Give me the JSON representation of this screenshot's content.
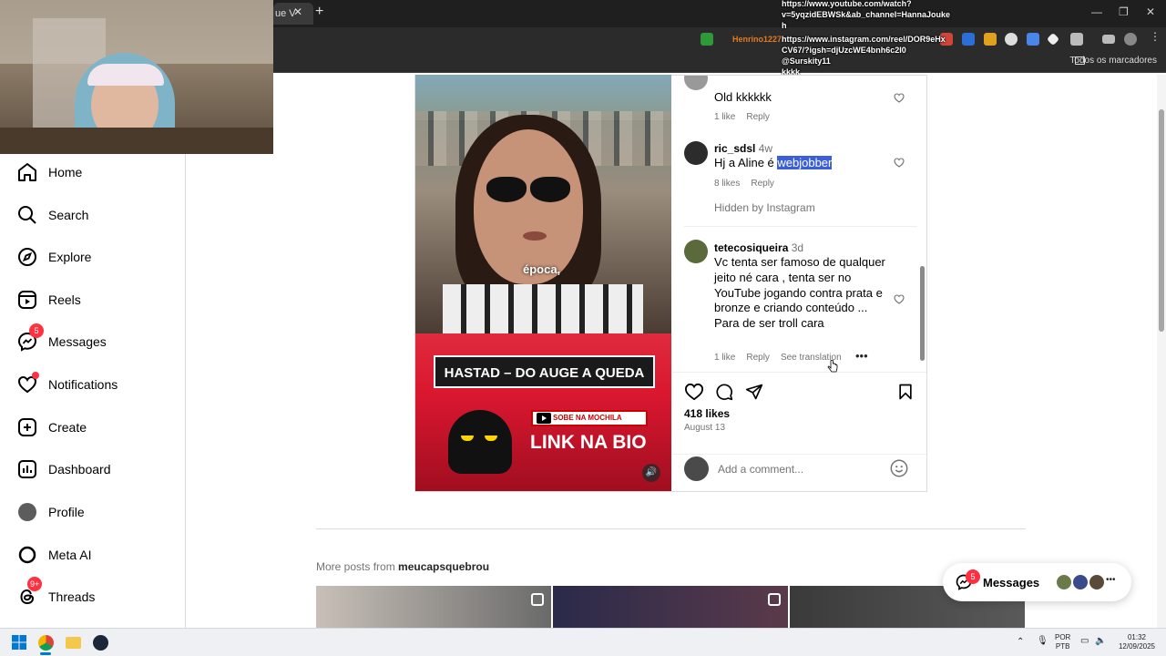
{
  "browser": {
    "tab_title": "ue V",
    "bookmarks_label": "Todos os marcadores",
    "overlay_lines": [
      "https://www.youtube.com/watch?",
      "v=5yqzidEBWSk&ab_channel=HannaJouke",
      "h",
      "https://www.instagram.com/reel/DOR9eHx",
      "CV67/?igsh=djUzcWE4bnh6c2I0",
      "@Surskity11",
      "kkkk"
    ],
    "overlay_user": "Henrino1227"
  },
  "nav": {
    "items": [
      {
        "label": "Home",
        "icon": "home-icon"
      },
      {
        "label": "Search",
        "icon": "search-icon"
      },
      {
        "label": "Explore",
        "icon": "compass-icon"
      },
      {
        "label": "Reels",
        "icon": "reels-icon"
      },
      {
        "label": "Messages",
        "icon": "messenger-icon",
        "badge": "5"
      },
      {
        "label": "Notifications",
        "icon": "heart-icon"
      },
      {
        "label": "Create",
        "icon": "plus-square-icon"
      },
      {
        "label": "Dashboard",
        "icon": "dashboard-icon"
      },
      {
        "label": "Profile",
        "icon": "profile-avatar"
      },
      {
        "label": "Meta AI",
        "icon": "meta-ai-icon"
      },
      {
        "label": "Threads",
        "icon": "threads-icon",
        "badge": "9+"
      }
    ]
  },
  "media": {
    "caption": "época,",
    "promo_title": "HASTAD – DO AUGE A QUEDA",
    "promo_button": "SOBE NA MOCHILA",
    "promo_link": "LINK NA BIO"
  },
  "comments": [
    {
      "user": "",
      "time": "",
      "text": "Old kkkkkk",
      "likes": "1 like",
      "reply": "Reply"
    },
    {
      "user": "ric_sdsl",
      "time": "4w",
      "text_before": "Hj a Aline é ",
      "text_highlight": "webjobber",
      "likes": "8 likes",
      "reply": "Reply"
    },
    {
      "hidden": "Hidden by Instagram"
    },
    {
      "user": "tetecosiqueira",
      "time": "3d",
      "text": "Vc tenta ser famoso de qualquer jeito né cara , tenta ser no YouTube jogando contra prata e bronze e criando conteúdo ... Para de ser troll cara",
      "likes": "1 like",
      "reply": "Reply",
      "translate": "See translation"
    }
  ],
  "post": {
    "likes": "418 likes",
    "date": "August 13",
    "comment_placeholder": "Add a comment..."
  },
  "more_posts": {
    "prefix": "More posts from ",
    "username": "meucapsquebrou"
  },
  "messages_pill": {
    "label": "Messages",
    "badge": "5"
  },
  "taskbar": {
    "lang_line1": "POR",
    "lang_line2": "PTB",
    "time": "01:32",
    "date": "12/09/2025"
  },
  "colors": {
    "badge": "#ff3040",
    "highlight": "#3b5fd9",
    "promo_red": "#d9172f"
  }
}
